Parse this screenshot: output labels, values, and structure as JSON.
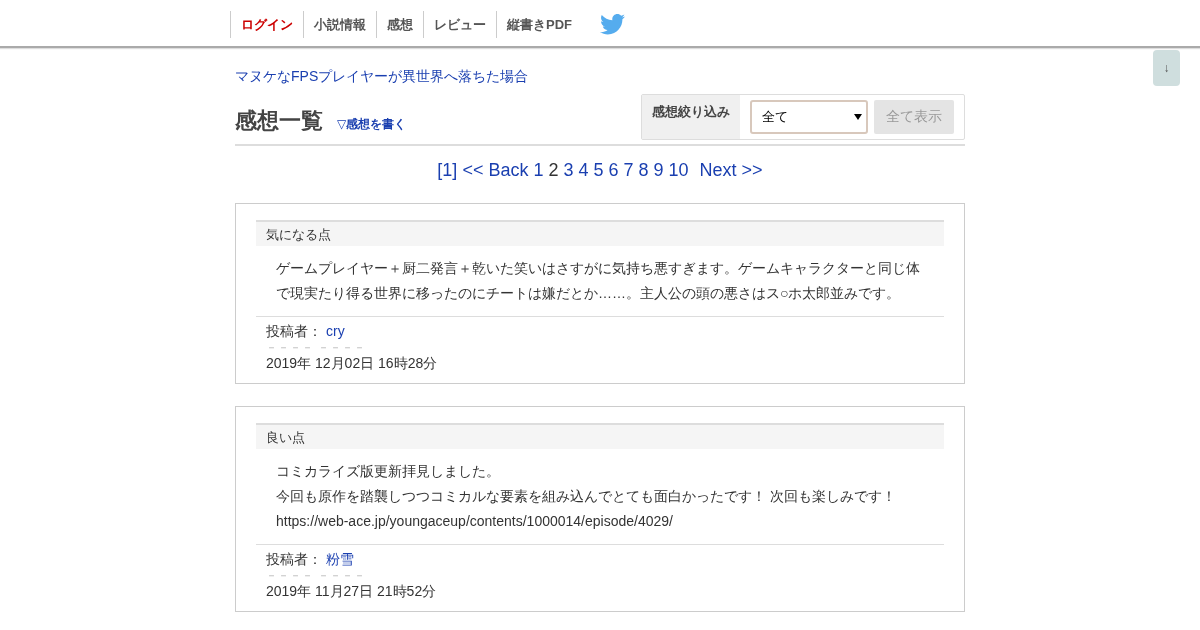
{
  "nav": {
    "items": [
      {
        "label": "ログイン",
        "kind": "login"
      },
      {
        "label": "小説情報",
        "kind": "link"
      },
      {
        "label": "感想",
        "kind": "link"
      },
      {
        "label": "レビュー",
        "kind": "link"
      },
      {
        "label": "縦書きPDF",
        "kind": "link"
      }
    ]
  },
  "scroll_button": "↓",
  "novel_title": "マヌケなFPSプレイヤーが異世界へ落ちた場合",
  "heading": "感想一覧",
  "write_link": "▽感想を書く",
  "filter": {
    "label": "感想絞り込み",
    "value": "全て",
    "button": "全て表示"
  },
  "pagination": {
    "first": "[1]",
    "back": "<< Back",
    "pages": [
      {
        "label": "1",
        "selected": false
      },
      {
        "label": "2",
        "selected": true
      },
      {
        "label": "3",
        "selected": false
      },
      {
        "label": "4",
        "selected": false
      },
      {
        "label": "5",
        "selected": false
      },
      {
        "label": "6",
        "selected": false
      },
      {
        "label": "7",
        "selected": false
      },
      {
        "label": "8",
        "selected": false
      },
      {
        "label": "9",
        "selected": false
      },
      {
        "label": "10",
        "selected": false
      }
    ],
    "next": "Next >>"
  },
  "comments": [
    {
      "section": "気になる点",
      "lines": [
        "ゲームプレイヤー＋厨二発言＋乾いた笑いはさすがに気持ち悪すぎます。ゲームキャラクターと同じ体で現実たり得る世界に移ったのにチートは嫌だとか……。主人公の頭の悪さはス○ホ太郎並みです。"
      ],
      "author_label": "投稿者：",
      "author": "cry",
      "separator": "－－－－ －－－－",
      "date": "2019年 12月02日 16時28分"
    },
    {
      "section": "良い点",
      "lines": [
        "コミカライズ版更新拝見しました。",
        "今回も原作を踏襲しつつコミカルな要素を組み込んでとても面白かったです！ 次回も楽しみです！",
        "https://web-ace.jp/youngaceup/contents/1000014/episode/4029/"
      ],
      "author_label": "投稿者：",
      "author": "粉雪",
      "separator": "－－－－ －－－－",
      "date": "2019年 11月27日 21時52分"
    }
  ]
}
